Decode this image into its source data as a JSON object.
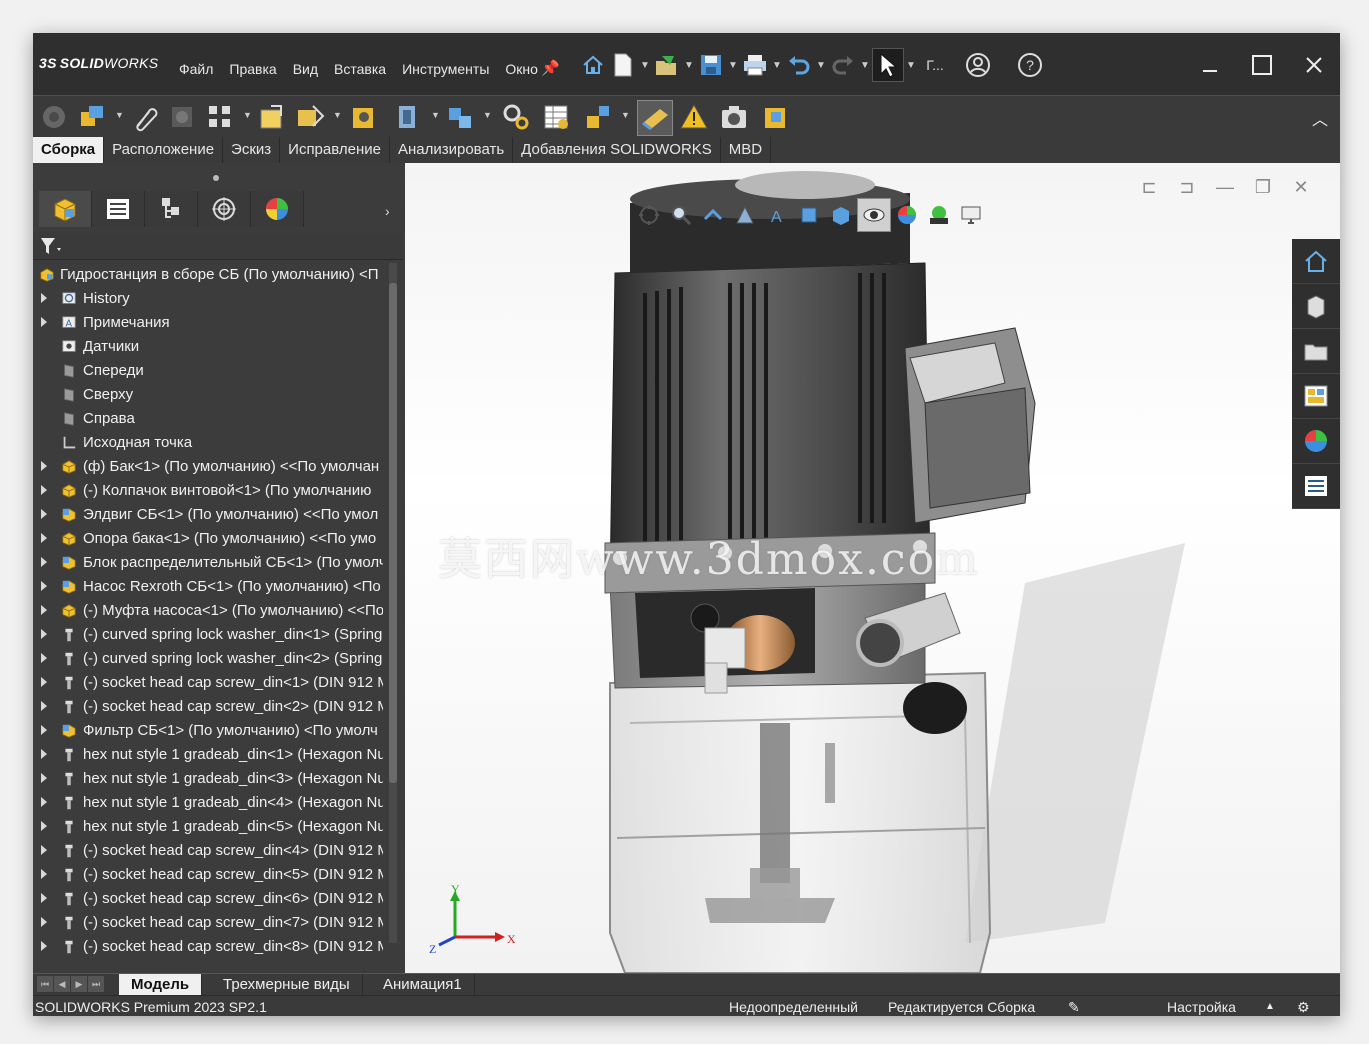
{
  "app": {
    "logo_prefix": "3S",
    "logo_bold": "SOLID",
    "logo_rest": "WORKS"
  },
  "menu": [
    "Файл",
    "Правка",
    "Вид",
    "Вставка",
    "Инструменты",
    "Окно"
  ],
  "title_truncated": "Г...",
  "tabs": [
    "Сборка",
    "Расположение",
    "Эскиз",
    "Исправление",
    "Анализировать",
    "Добавления SOLIDWORKS",
    "MBD"
  ],
  "tree": {
    "root": "Гидростанция в сборе СБ (По умолчанию) <П",
    "items": [
      {
        "label": "History",
        "expand": true,
        "icon": "history-icon"
      },
      {
        "label": "Примечания",
        "expand": true,
        "icon": "annotations-icon"
      },
      {
        "label": "Датчики",
        "expand": false,
        "icon": "sensors-icon"
      },
      {
        "label": "Спереди",
        "expand": false,
        "icon": "plane-icon"
      },
      {
        "label": "Сверху",
        "expand": false,
        "icon": "plane-icon"
      },
      {
        "label": "Справа",
        "expand": false,
        "icon": "plane-icon"
      },
      {
        "label": "Исходная точка",
        "expand": false,
        "icon": "origin-icon"
      },
      {
        "label": "(ф) Бак<1> (По умолчанию) <<По умолчан",
        "expand": true,
        "icon": "part-icon"
      },
      {
        "label": "(-) Колпачок винтовой<1> (По умолчанию",
        "expand": true,
        "icon": "part-icon"
      },
      {
        "label": "Элдвиг СБ<1> (По умолчанию) <<По умол",
        "expand": true,
        "icon": "subassembly-icon"
      },
      {
        "label": "Опора бака<1> (По умолчанию) <<По умо",
        "expand": true,
        "icon": "part-icon"
      },
      {
        "label": "Блок распределительный СБ<1> (По умолч",
        "expand": true,
        "icon": "subassembly-icon"
      },
      {
        "label": "Насос Rexroth  СБ<1> (По умолчанию) <По",
        "expand": true,
        "icon": "subassembly-icon"
      },
      {
        "label": "(-) Муфта насоса<1> (По умолчанию) <<По",
        "expand": true,
        "icon": "part-icon"
      },
      {
        "label": "(-) curved spring lock washer_din<1> (Spring",
        "expand": true,
        "icon": "fastener-icon"
      },
      {
        "label": "(-) curved spring lock washer_din<2> (Spring",
        "expand": true,
        "icon": "fastener-icon"
      },
      {
        "label": "(-) socket head cap screw_din<1> (DIN 912 M",
        "expand": true,
        "icon": "fastener-icon"
      },
      {
        "label": "(-) socket head cap screw_din<2> (DIN 912 M",
        "expand": true,
        "icon": "fastener-icon"
      },
      {
        "label": "Фильтр СБ<1> (По умолчанию) <По умолч",
        "expand": true,
        "icon": "subassembly-icon"
      },
      {
        "label": "hex nut style 1 gradeab_din<1> (Hexagon Nu",
        "expand": true,
        "icon": "fastener-icon"
      },
      {
        "label": "hex nut style 1 gradeab_din<3> (Hexagon Nu",
        "expand": true,
        "icon": "fastener-icon"
      },
      {
        "label": "hex nut style 1 gradeab_din<4> (Hexagon Nu",
        "expand": true,
        "icon": "fastener-icon"
      },
      {
        "label": "hex nut style 1 gradeab_din<5> (Hexagon Nu",
        "expand": true,
        "icon": "fastener-icon"
      },
      {
        "label": "(-) socket head cap screw_din<4> (DIN 912 M",
        "expand": true,
        "icon": "fastener-icon"
      },
      {
        "label": "(-) socket head cap screw_din<5> (DIN 912 M",
        "expand": true,
        "icon": "fastener-icon"
      },
      {
        "label": "(-) socket head cap screw_din<6> (DIN 912 M",
        "expand": true,
        "icon": "fastener-icon"
      },
      {
        "label": "(-) socket head cap screw_din<7> (DIN 912 M",
        "expand": true,
        "icon": "fastener-icon"
      },
      {
        "label": "(-) socket head cap screw_din<8> (DIN 912 M",
        "expand": true,
        "icon": "fastener-icon"
      }
    ]
  },
  "watermark": "莫西网www.3dmox.com",
  "triad": {
    "x": "X",
    "y": "Y",
    "z": "Z"
  },
  "bottom_tabs": [
    "Модель",
    "Трехмерные виды",
    "Анимация1"
  ],
  "status": {
    "version": "SOLIDWORKS Premium 2023 SP2.1",
    "state": "Недоопределенный",
    "editing": "Редактируется Сборка",
    "custom": "Настройка"
  },
  "colors": {
    "accent": "#e8b830",
    "axis_x": "#cc2222",
    "axis_y": "#22aa22",
    "axis_z": "#2244cc"
  }
}
